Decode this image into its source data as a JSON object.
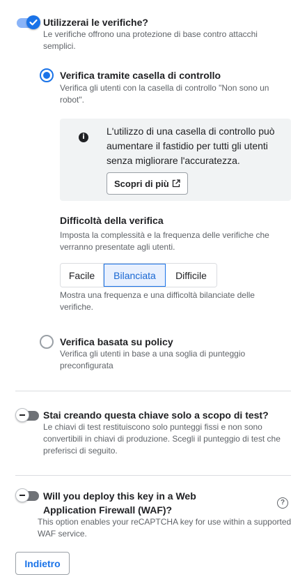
{
  "checks": {
    "enabled": true,
    "title": "Utilizzerai le verifiche?",
    "description": "Le verifiche offrono una protezione di base contro attacchi semplici."
  },
  "checkbox_option": {
    "selected": true,
    "title": "Verifica tramite casella di controllo",
    "description": "Verifica gli utenti con la casella di controllo \"Non sono un robot\"."
  },
  "info": {
    "icon": "info-icon",
    "text": "L'utilizzo di una casella di controllo può aumentare il fastidio per tutti gli utenti senza migliorare l'accuratezza.",
    "learn_more_label": "Scopri di più",
    "learn_more_icon": "open-in-new-icon"
  },
  "difficulty": {
    "title": "Difficoltà della verifica",
    "description": "Imposta la complessità e la frequenza delle verifiche che verranno presentate agli utenti.",
    "options": [
      "Facile",
      "Bilanciata",
      "Difficile"
    ],
    "selected": "Bilanciata",
    "selected_description": "Mostra una frequenza e una difficoltà bilanciate delle verifiche."
  },
  "policy_option": {
    "selected": false,
    "title": "Verifica basata su policy",
    "description": "Verifica gli utenti in base a una soglia di punteggio preconfigurata"
  },
  "test_key": {
    "enabled": false,
    "title": "Stai creando questa chiave solo a scopo di test?",
    "description": "Le chiavi di test restituiscono solo punteggi fissi e non sono convertibili in chiavi di produzione. Scegli il punteggio di test che preferisci di seguito."
  },
  "waf": {
    "enabled": false,
    "title": "Will you deploy this key in a Web Application Firewall (WAF)?",
    "description": "This option enables your reCAPTCHA key for use within a supported WAF service.",
    "help_icon": "help-icon"
  },
  "back_label": "Indietro",
  "colors": {
    "accent": "#1a73e8",
    "info_bg": "#f1f3f4",
    "divider": "#dadce0"
  }
}
